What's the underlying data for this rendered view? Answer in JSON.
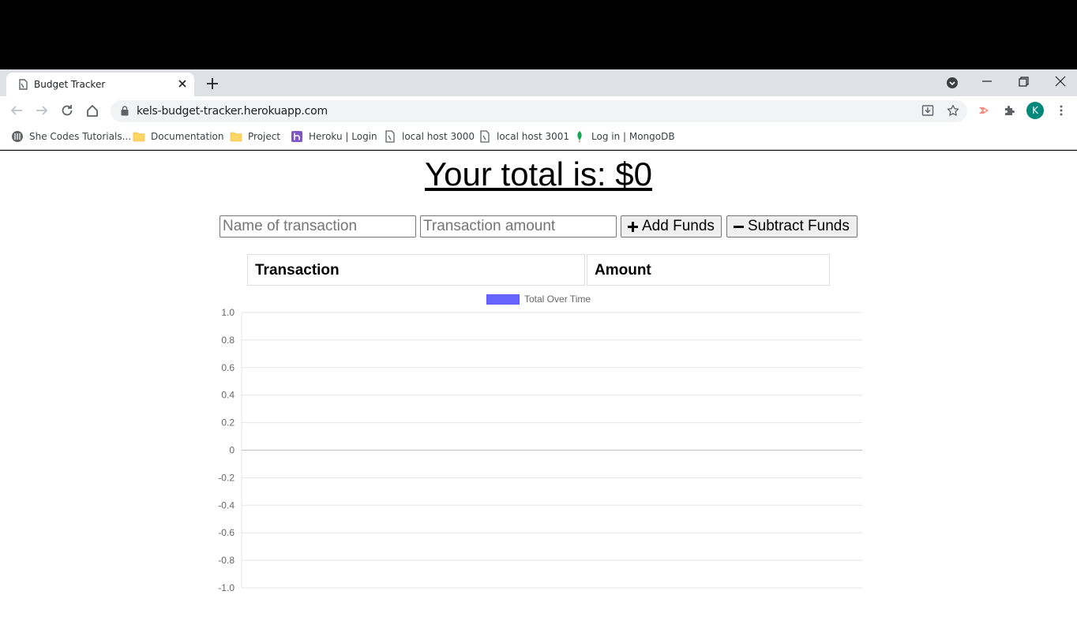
{
  "browser": {
    "tab_title": "Budget Tracker",
    "url": "kels-budget-tracker.herokuapp.com",
    "profile_initial": "K",
    "bookmarks": [
      {
        "label": "She Codes Tutorials...",
        "icon": "shecodes-icon"
      },
      {
        "label": "Documentation",
        "icon": "folder-icon"
      },
      {
        "label": "Project",
        "icon": "folder-icon"
      },
      {
        "label": "Heroku | Login",
        "icon": "heroku-icon"
      },
      {
        "label": "local host 3000",
        "icon": "page-icon"
      },
      {
        "label": "local host 3001",
        "icon": "page-icon"
      },
      {
        "label": "Log in | MongoDB",
        "icon": "mongodb-leaf-icon"
      }
    ]
  },
  "app": {
    "total_label": "Your total is: $",
    "total_value": "0",
    "name_placeholder": "Name of transaction",
    "amount_placeholder": "Transaction amount",
    "add_label": "Add Funds",
    "subtract_label": "Subtract Funds",
    "table_headers": [
      "Transaction",
      "Amount"
    ]
  },
  "chart_data": {
    "type": "line",
    "series": [
      {
        "name": "Total Over Time",
        "values": [],
        "color": "#6666ff"
      }
    ],
    "x": [],
    "ylim": [
      -1.0,
      1.0
    ],
    "yticks": [
      "1.0",
      "0.8",
      "0.6",
      "0.4",
      "0.2",
      "0",
      "-0.2",
      "-0.4",
      "-0.6",
      "-0.8",
      "-1.0"
    ],
    "grid": true,
    "legend": "top-center"
  }
}
